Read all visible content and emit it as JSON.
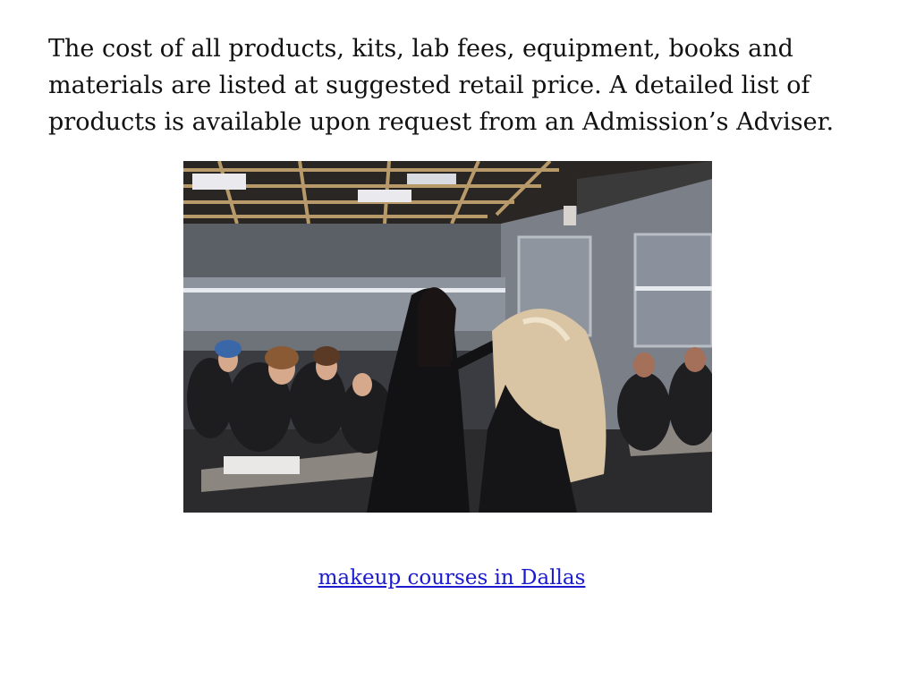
{
  "content": {
    "paragraph": "The cost of all products, kits, lab fees, equipment, books and materials are listed at suggested retail price. A detailed list of products is available upon request from an Admission’s Adviser.",
    "link_text": "makeup courses in Dallas"
  },
  "colors": {
    "text": "#111111",
    "link": "#1a1ad0",
    "background": "#ffffff"
  }
}
